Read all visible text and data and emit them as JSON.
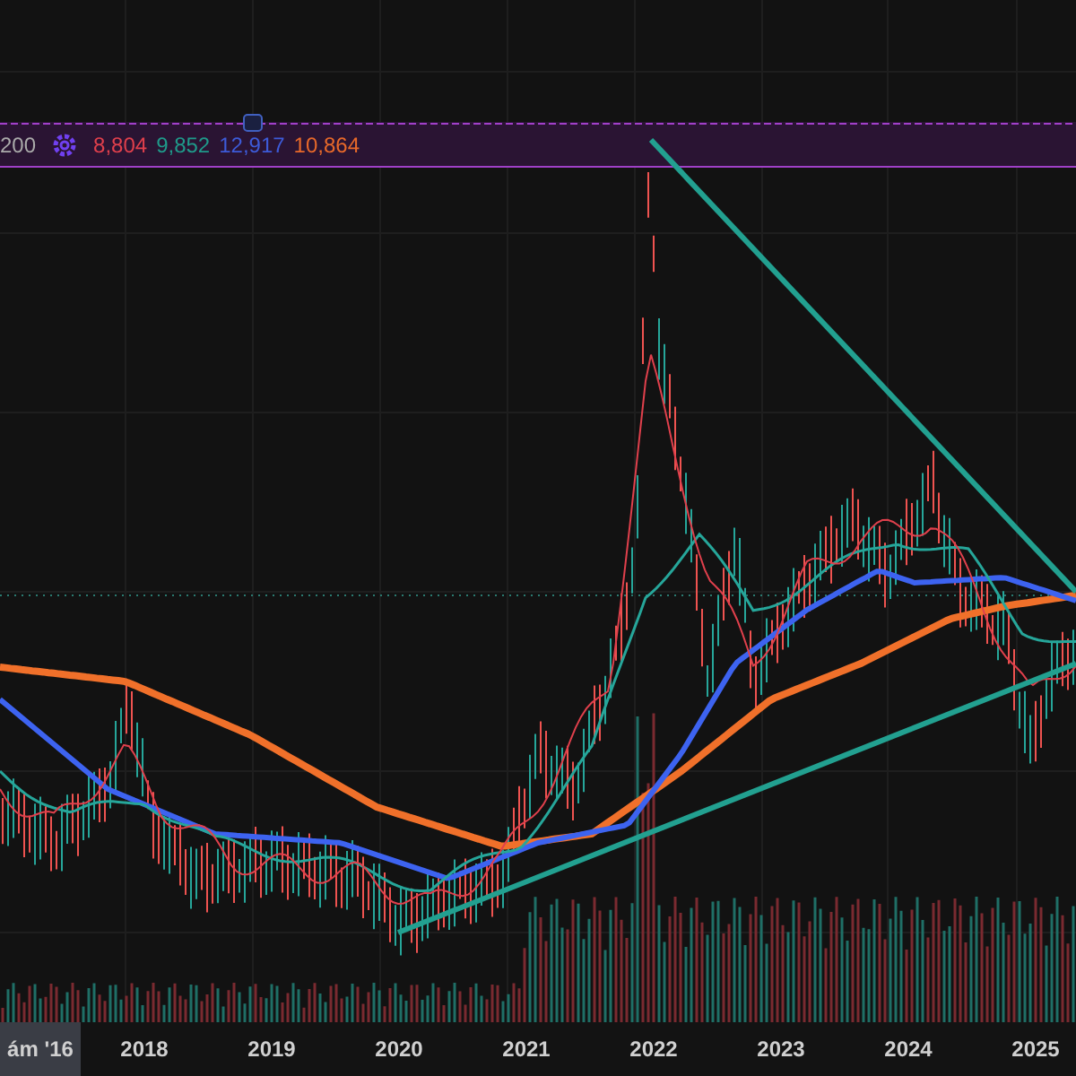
{
  "indicator_legend": {
    "length": "200",
    "values": [
      {
        "text": "8,804",
        "color": "#e0404c"
      },
      {
        "text": "9,852",
        "color": "#1f9a8a"
      },
      {
        "text": "12,917",
        "color": "#3d5bd8"
      },
      {
        "text": "10,864",
        "color": "#e8692a"
      }
    ]
  },
  "time_axis": [
    {
      "label": "ám '16",
      "highlighted": true
    },
    {
      "label": "2018",
      "highlighted": false
    },
    {
      "label": "2019",
      "highlighted": false
    },
    {
      "label": "2020",
      "highlighted": false
    },
    {
      "label": "2021",
      "highlighted": false
    },
    {
      "label": "2022",
      "highlighted": false
    },
    {
      "label": "2023",
      "highlighted": false
    },
    {
      "label": "2024",
      "highlighted": false
    },
    {
      "label": "2025",
      "highlighted": false
    }
  ]
}
